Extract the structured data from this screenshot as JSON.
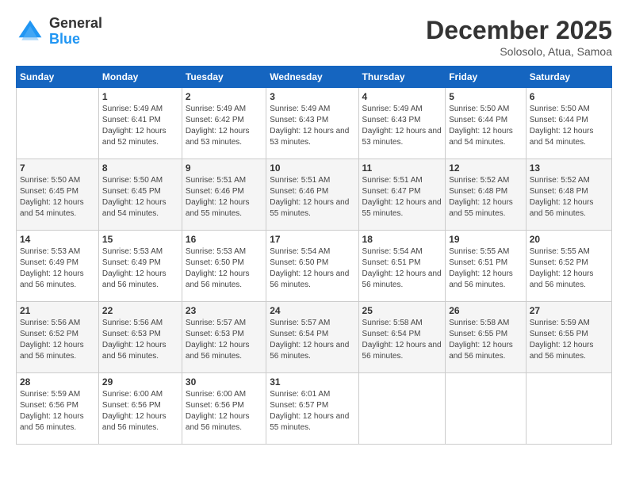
{
  "header": {
    "logo_general": "General",
    "logo_blue": "Blue",
    "title": "December 2025",
    "subtitle": "Solosolo, Atua, Samoa"
  },
  "weekdays": [
    "Sunday",
    "Monday",
    "Tuesday",
    "Wednesday",
    "Thursday",
    "Friday",
    "Saturday"
  ],
  "weeks": [
    [
      {
        "day": "",
        "sunrise": "",
        "sunset": "",
        "daylight": ""
      },
      {
        "day": "1",
        "sunrise": "Sunrise: 5:49 AM",
        "sunset": "Sunset: 6:41 PM",
        "daylight": "Daylight: 12 hours and 52 minutes."
      },
      {
        "day": "2",
        "sunrise": "Sunrise: 5:49 AM",
        "sunset": "Sunset: 6:42 PM",
        "daylight": "Daylight: 12 hours and 53 minutes."
      },
      {
        "day": "3",
        "sunrise": "Sunrise: 5:49 AM",
        "sunset": "Sunset: 6:43 PM",
        "daylight": "Daylight: 12 hours and 53 minutes."
      },
      {
        "day": "4",
        "sunrise": "Sunrise: 5:49 AM",
        "sunset": "Sunset: 6:43 PM",
        "daylight": "Daylight: 12 hours and 53 minutes."
      },
      {
        "day": "5",
        "sunrise": "Sunrise: 5:50 AM",
        "sunset": "Sunset: 6:44 PM",
        "daylight": "Daylight: 12 hours and 54 minutes."
      },
      {
        "day": "6",
        "sunrise": "Sunrise: 5:50 AM",
        "sunset": "Sunset: 6:44 PM",
        "daylight": "Daylight: 12 hours and 54 minutes."
      }
    ],
    [
      {
        "day": "7",
        "sunrise": "Sunrise: 5:50 AM",
        "sunset": "Sunset: 6:45 PM",
        "daylight": "Daylight: 12 hours and 54 minutes."
      },
      {
        "day": "8",
        "sunrise": "Sunrise: 5:50 AM",
        "sunset": "Sunset: 6:45 PM",
        "daylight": "Daylight: 12 hours and 54 minutes."
      },
      {
        "day": "9",
        "sunrise": "Sunrise: 5:51 AM",
        "sunset": "Sunset: 6:46 PM",
        "daylight": "Daylight: 12 hours and 55 minutes."
      },
      {
        "day": "10",
        "sunrise": "Sunrise: 5:51 AM",
        "sunset": "Sunset: 6:46 PM",
        "daylight": "Daylight: 12 hours and 55 minutes."
      },
      {
        "day": "11",
        "sunrise": "Sunrise: 5:51 AM",
        "sunset": "Sunset: 6:47 PM",
        "daylight": "Daylight: 12 hours and 55 minutes."
      },
      {
        "day": "12",
        "sunrise": "Sunrise: 5:52 AM",
        "sunset": "Sunset: 6:48 PM",
        "daylight": "Daylight: 12 hours and 55 minutes."
      },
      {
        "day": "13",
        "sunrise": "Sunrise: 5:52 AM",
        "sunset": "Sunset: 6:48 PM",
        "daylight": "Daylight: 12 hours and 56 minutes."
      }
    ],
    [
      {
        "day": "14",
        "sunrise": "Sunrise: 5:53 AM",
        "sunset": "Sunset: 6:49 PM",
        "daylight": "Daylight: 12 hours and 56 minutes."
      },
      {
        "day": "15",
        "sunrise": "Sunrise: 5:53 AM",
        "sunset": "Sunset: 6:49 PM",
        "daylight": "Daylight: 12 hours and 56 minutes."
      },
      {
        "day": "16",
        "sunrise": "Sunrise: 5:53 AM",
        "sunset": "Sunset: 6:50 PM",
        "daylight": "Daylight: 12 hours and 56 minutes."
      },
      {
        "day": "17",
        "sunrise": "Sunrise: 5:54 AM",
        "sunset": "Sunset: 6:50 PM",
        "daylight": "Daylight: 12 hours and 56 minutes."
      },
      {
        "day": "18",
        "sunrise": "Sunrise: 5:54 AM",
        "sunset": "Sunset: 6:51 PM",
        "daylight": "Daylight: 12 hours and 56 minutes."
      },
      {
        "day": "19",
        "sunrise": "Sunrise: 5:55 AM",
        "sunset": "Sunset: 6:51 PM",
        "daylight": "Daylight: 12 hours and 56 minutes."
      },
      {
        "day": "20",
        "sunrise": "Sunrise: 5:55 AM",
        "sunset": "Sunset: 6:52 PM",
        "daylight": "Daylight: 12 hours and 56 minutes."
      }
    ],
    [
      {
        "day": "21",
        "sunrise": "Sunrise: 5:56 AM",
        "sunset": "Sunset: 6:52 PM",
        "daylight": "Daylight: 12 hours and 56 minutes."
      },
      {
        "day": "22",
        "sunrise": "Sunrise: 5:56 AM",
        "sunset": "Sunset: 6:53 PM",
        "daylight": "Daylight: 12 hours and 56 minutes."
      },
      {
        "day": "23",
        "sunrise": "Sunrise: 5:57 AM",
        "sunset": "Sunset: 6:53 PM",
        "daylight": "Daylight: 12 hours and 56 minutes."
      },
      {
        "day": "24",
        "sunrise": "Sunrise: 5:57 AM",
        "sunset": "Sunset: 6:54 PM",
        "daylight": "Daylight: 12 hours and 56 minutes."
      },
      {
        "day": "25",
        "sunrise": "Sunrise: 5:58 AM",
        "sunset": "Sunset: 6:54 PM",
        "daylight": "Daylight: 12 hours and 56 minutes."
      },
      {
        "day": "26",
        "sunrise": "Sunrise: 5:58 AM",
        "sunset": "Sunset: 6:55 PM",
        "daylight": "Daylight: 12 hours and 56 minutes."
      },
      {
        "day": "27",
        "sunrise": "Sunrise: 5:59 AM",
        "sunset": "Sunset: 6:55 PM",
        "daylight": "Daylight: 12 hours and 56 minutes."
      }
    ],
    [
      {
        "day": "28",
        "sunrise": "Sunrise: 5:59 AM",
        "sunset": "Sunset: 6:56 PM",
        "daylight": "Daylight: 12 hours and 56 minutes."
      },
      {
        "day": "29",
        "sunrise": "Sunrise: 6:00 AM",
        "sunset": "Sunset: 6:56 PM",
        "daylight": "Daylight: 12 hours and 56 minutes."
      },
      {
        "day": "30",
        "sunrise": "Sunrise: 6:00 AM",
        "sunset": "Sunset: 6:56 PM",
        "daylight": "Daylight: 12 hours and 56 minutes."
      },
      {
        "day": "31",
        "sunrise": "Sunrise: 6:01 AM",
        "sunset": "Sunset: 6:57 PM",
        "daylight": "Daylight: 12 hours and 55 minutes."
      },
      {
        "day": "",
        "sunrise": "",
        "sunset": "",
        "daylight": ""
      },
      {
        "day": "",
        "sunrise": "",
        "sunset": "",
        "daylight": ""
      },
      {
        "day": "",
        "sunrise": "",
        "sunset": "",
        "daylight": ""
      }
    ]
  ]
}
